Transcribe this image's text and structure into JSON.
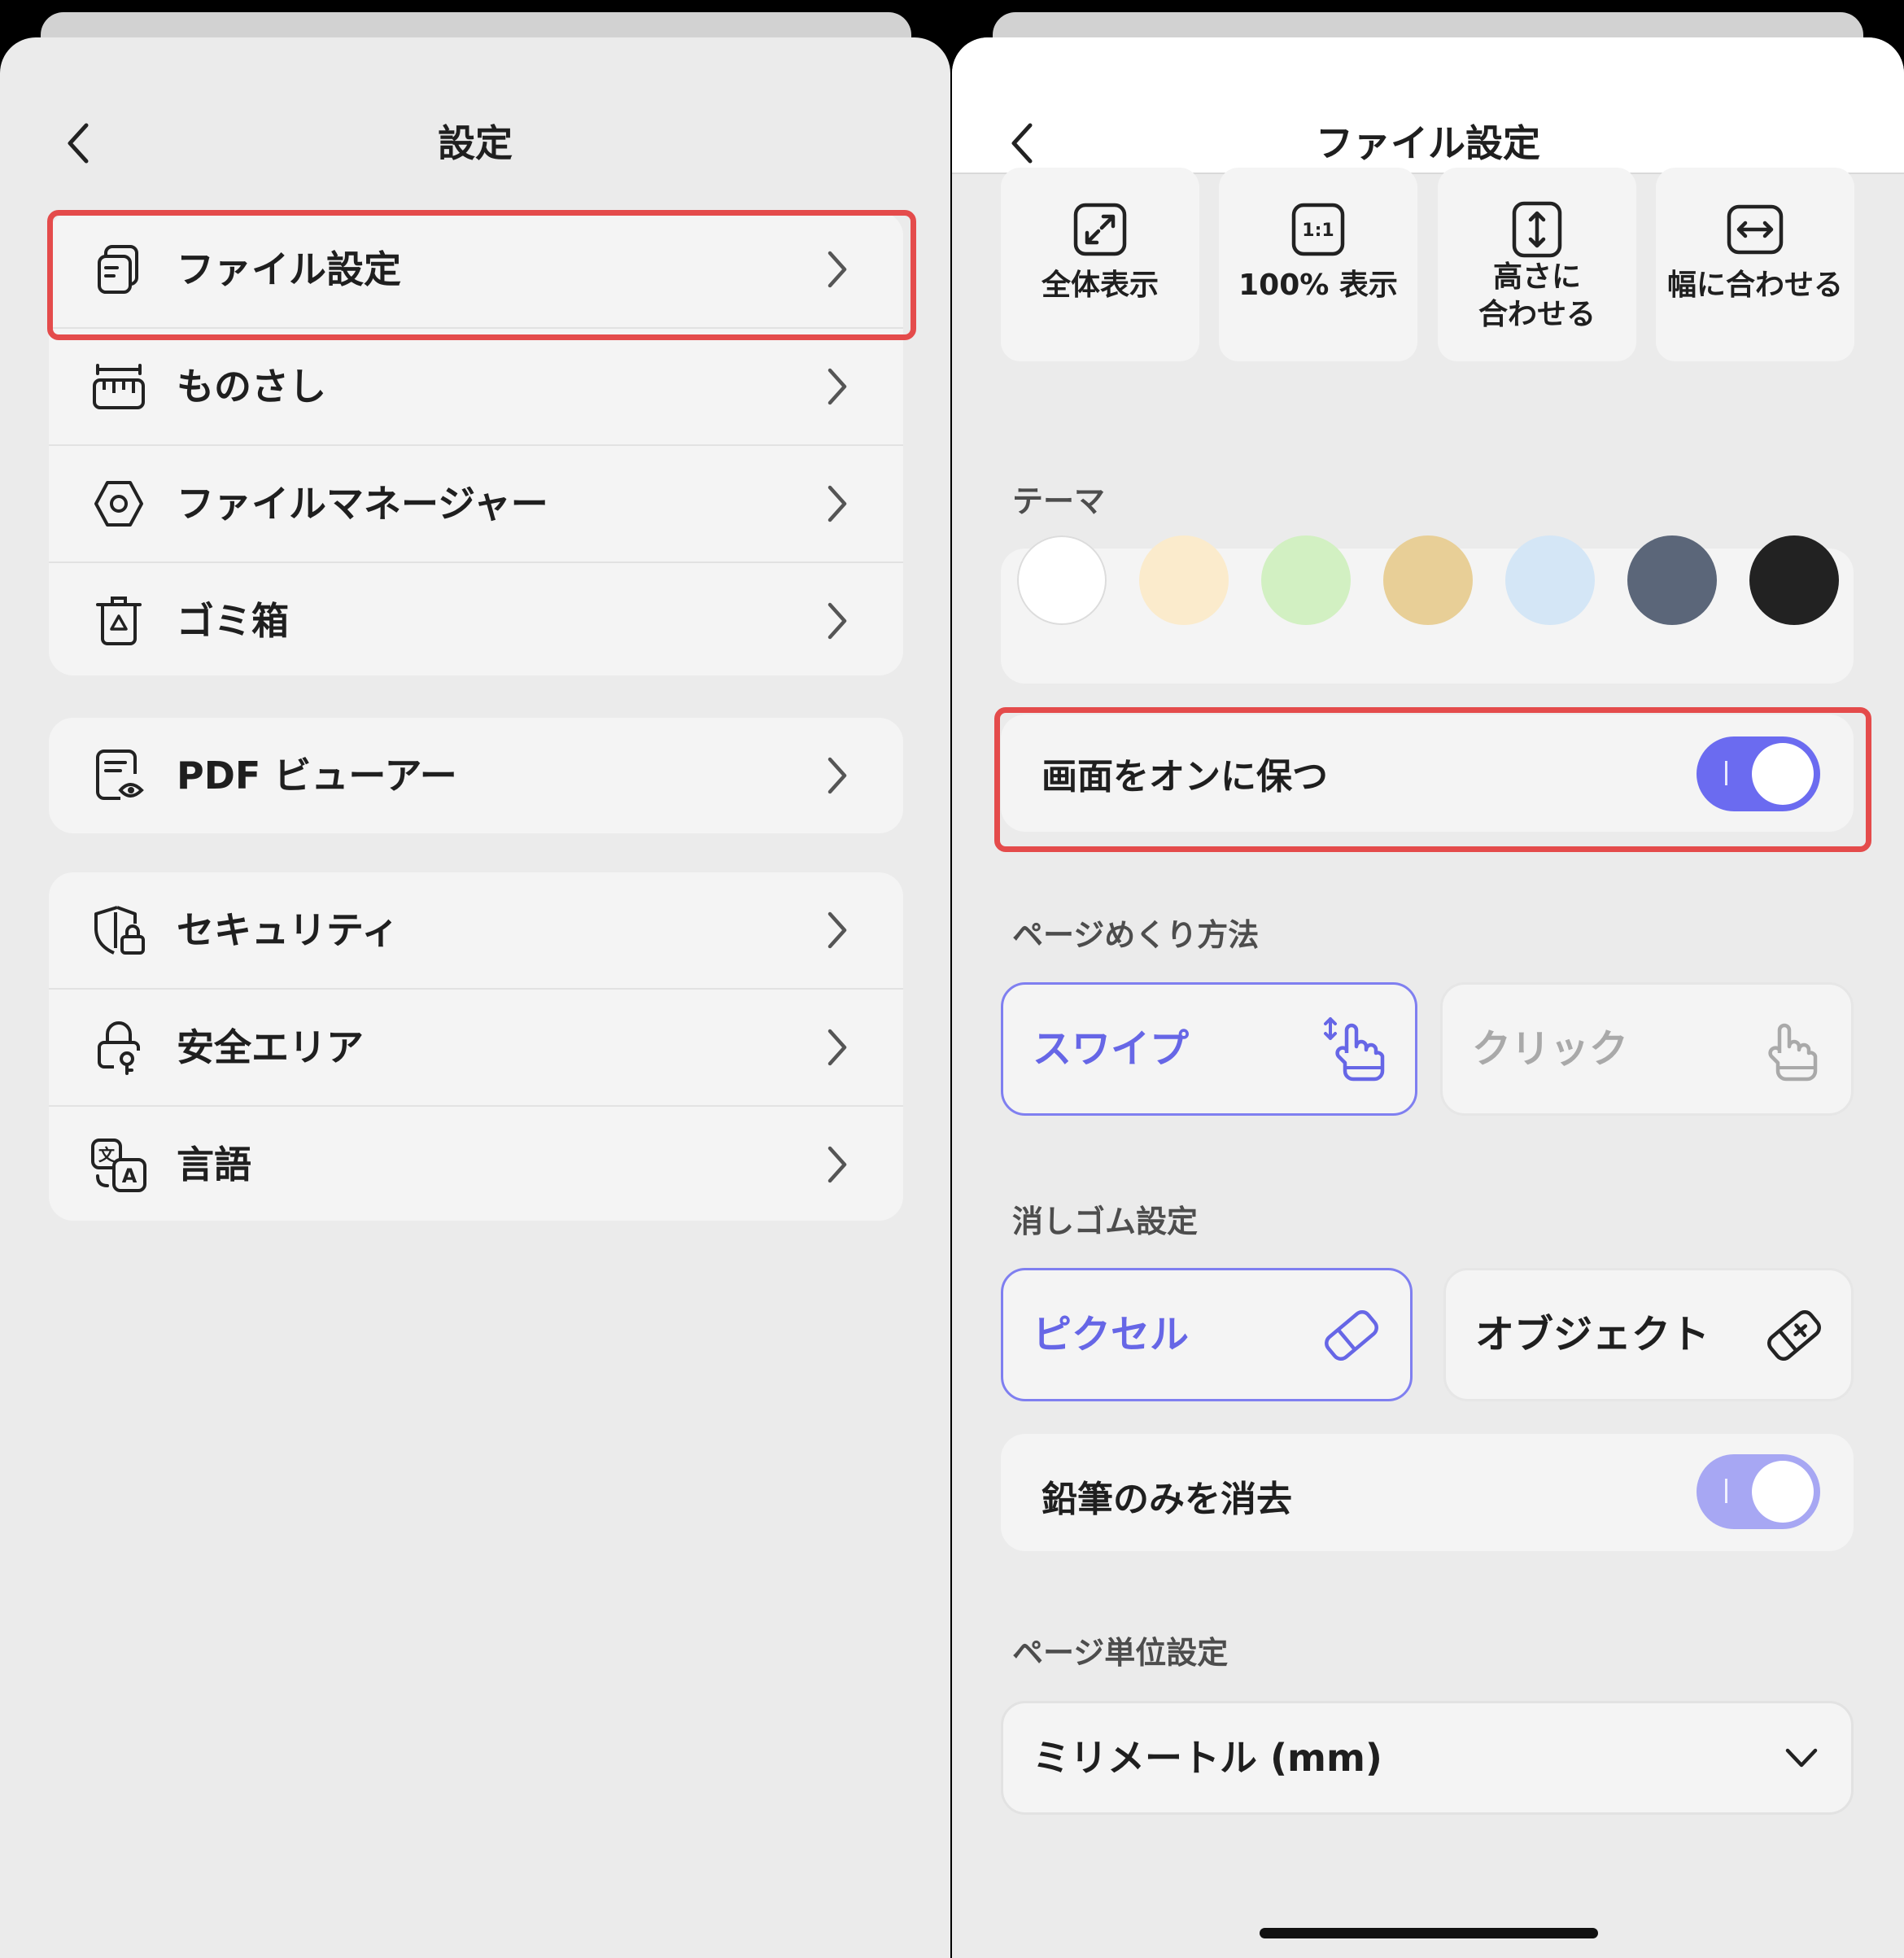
{
  "left": {
    "title": "設定",
    "groups": [
      {
        "items": [
          {
            "label": "ファイル設定",
            "icon": "file-settings-icon",
            "highlighted": true
          },
          {
            "label": "ものさし",
            "icon": "ruler-icon"
          },
          {
            "label": "ファイルマネージャー",
            "icon": "hexagon-icon"
          },
          {
            "label": "ゴミ箱",
            "icon": "trash-icon"
          }
        ]
      },
      {
        "items": [
          {
            "label": "PDF ビューアー",
            "icon": "pdf-viewer-icon"
          }
        ]
      },
      {
        "items": [
          {
            "label": "セキュリティ",
            "icon": "shield-lock-icon"
          },
          {
            "label": "安全エリア",
            "icon": "lock-key-icon"
          },
          {
            "label": "言語",
            "icon": "translate-icon"
          }
        ]
      }
    ]
  },
  "right": {
    "title": "ファイル設定",
    "view_modes": [
      {
        "label": "全体表示",
        "icon": "expand-icon"
      },
      {
        "label": "100% 表示",
        "icon": "one-to-one-icon"
      },
      {
        "label": "高さに\n合わせる",
        "icon": "fit-height-icon"
      },
      {
        "label": "幅に合わせる",
        "icon": "fit-width-icon"
      }
    ],
    "theme": {
      "label": "テーマ",
      "colors": [
        "#ffffff",
        "#fbebcc",
        "#d2f0c2",
        "#e8cf97",
        "#d4e6f6",
        "#5b6679",
        "#222222"
      ]
    },
    "keep_screen_on": {
      "label": "画面をオンに保つ",
      "on": true,
      "highlighted": true
    },
    "page_turn": {
      "label": "ページめくり方法",
      "options": [
        {
          "label": "スワイプ",
          "selected": true,
          "icon": "swipe-hand-icon"
        },
        {
          "label": "クリック",
          "selected": false,
          "icon": "tap-hand-icon"
        }
      ]
    },
    "eraser": {
      "label": "消しゴム設定",
      "options": [
        {
          "label": "ピクセル",
          "selected": true,
          "icon": "eraser-icon"
        },
        {
          "label": "オブジェクト",
          "selected": false,
          "icon": "object-eraser-icon"
        }
      ]
    },
    "erase_pencil_only": {
      "label": "鉛筆のみを消去",
      "on": true
    },
    "page_unit": {
      "label": "ページ単位設定",
      "value": "ミリメートル (mm)"
    }
  },
  "colors": {
    "accent": "#6b6bf0",
    "accent_soft": "#a7a7f3",
    "highlight": "#e44b4b"
  }
}
